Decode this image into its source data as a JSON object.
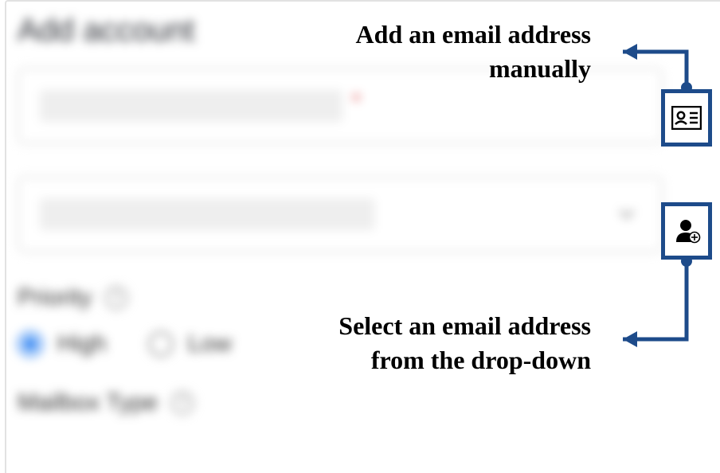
{
  "page": {
    "title": "Add account"
  },
  "annotations": {
    "manual_line1": "Add an email address",
    "manual_line2": "manually",
    "dropdown_line1": "Select an email address",
    "dropdown_line2": "from the drop-down"
  },
  "form": {
    "email": {
      "value": "",
      "required_marker": "*"
    },
    "dropdown": {
      "value": ""
    },
    "priority": {
      "label": "Priority",
      "options": {
        "high": "High",
        "low": "Low"
      },
      "selected": "high"
    },
    "mailbox_type": {
      "label": "Mailbox Type"
    },
    "help_glyph": "?"
  },
  "icons": {
    "manual_entry": "contact-card-icon",
    "add_from_dropdown": "add-user-icon"
  },
  "colors": {
    "accent": "#1d4b8a",
    "radio_selected": "#1976f0"
  }
}
